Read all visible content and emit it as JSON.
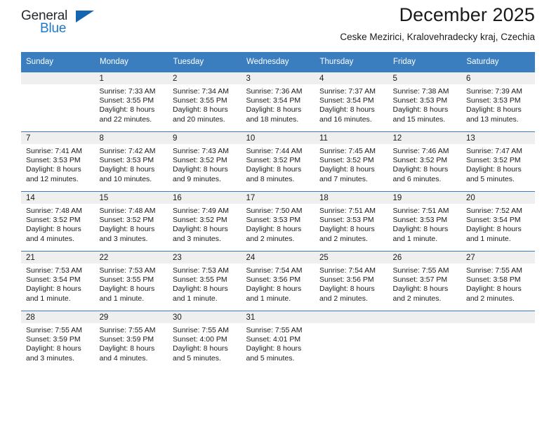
{
  "logo": {
    "word_one": "General",
    "word_two": "Blue",
    "triangle": "blue-triangle"
  },
  "header": {
    "title": "December 2025",
    "subtitle": "Ceske Mezirici, Kralovehradecky kraj, Czechia"
  },
  "colors": {
    "header_blue": "#3a7ebf",
    "logo_blue": "#2079c7",
    "daynum_background": "#efefef"
  },
  "labels": {
    "sunrise_prefix": "Sunrise:",
    "sunset_prefix": "Sunset:",
    "daylight_prefix": "Daylight:"
  },
  "weekdays": [
    "Sunday",
    "Monday",
    "Tuesday",
    "Wednesday",
    "Thursday",
    "Friday",
    "Saturday"
  ],
  "weeks": [
    [
      {
        "day": "",
        "sunrise": "",
        "sunset": "",
        "daylight_line1": "",
        "daylight_line2": ""
      },
      {
        "day": "1",
        "sunrise": "Sunrise: 7:33 AM",
        "sunset": "Sunset: 3:55 PM",
        "daylight_line1": "Daylight: 8 hours",
        "daylight_line2": "and 22 minutes."
      },
      {
        "day": "2",
        "sunrise": "Sunrise: 7:34 AM",
        "sunset": "Sunset: 3:55 PM",
        "daylight_line1": "Daylight: 8 hours",
        "daylight_line2": "and 20 minutes."
      },
      {
        "day": "3",
        "sunrise": "Sunrise: 7:36 AM",
        "sunset": "Sunset: 3:54 PM",
        "daylight_line1": "Daylight: 8 hours",
        "daylight_line2": "and 18 minutes."
      },
      {
        "day": "4",
        "sunrise": "Sunrise: 7:37 AM",
        "sunset": "Sunset: 3:54 PM",
        "daylight_line1": "Daylight: 8 hours",
        "daylight_line2": "and 16 minutes."
      },
      {
        "day": "5",
        "sunrise": "Sunrise: 7:38 AM",
        "sunset": "Sunset: 3:53 PM",
        "daylight_line1": "Daylight: 8 hours",
        "daylight_line2": "and 15 minutes."
      },
      {
        "day": "6",
        "sunrise": "Sunrise: 7:39 AM",
        "sunset": "Sunset: 3:53 PM",
        "daylight_line1": "Daylight: 8 hours",
        "daylight_line2": "and 13 minutes."
      }
    ],
    [
      {
        "day": "7",
        "sunrise": "Sunrise: 7:41 AM",
        "sunset": "Sunset: 3:53 PM",
        "daylight_line1": "Daylight: 8 hours",
        "daylight_line2": "and 12 minutes."
      },
      {
        "day": "8",
        "sunrise": "Sunrise: 7:42 AM",
        "sunset": "Sunset: 3:53 PM",
        "daylight_line1": "Daylight: 8 hours",
        "daylight_line2": "and 10 minutes."
      },
      {
        "day": "9",
        "sunrise": "Sunrise: 7:43 AM",
        "sunset": "Sunset: 3:52 PM",
        "daylight_line1": "Daylight: 8 hours",
        "daylight_line2": "and 9 minutes."
      },
      {
        "day": "10",
        "sunrise": "Sunrise: 7:44 AM",
        "sunset": "Sunset: 3:52 PM",
        "daylight_line1": "Daylight: 8 hours",
        "daylight_line2": "and 8 minutes."
      },
      {
        "day": "11",
        "sunrise": "Sunrise: 7:45 AM",
        "sunset": "Sunset: 3:52 PM",
        "daylight_line1": "Daylight: 8 hours",
        "daylight_line2": "and 7 minutes."
      },
      {
        "day": "12",
        "sunrise": "Sunrise: 7:46 AM",
        "sunset": "Sunset: 3:52 PM",
        "daylight_line1": "Daylight: 8 hours",
        "daylight_line2": "and 6 minutes."
      },
      {
        "day": "13",
        "sunrise": "Sunrise: 7:47 AM",
        "sunset": "Sunset: 3:52 PM",
        "daylight_line1": "Daylight: 8 hours",
        "daylight_line2": "and 5 minutes."
      }
    ],
    [
      {
        "day": "14",
        "sunrise": "Sunrise: 7:48 AM",
        "sunset": "Sunset: 3:52 PM",
        "daylight_line1": "Daylight: 8 hours",
        "daylight_line2": "and 4 minutes."
      },
      {
        "day": "15",
        "sunrise": "Sunrise: 7:48 AM",
        "sunset": "Sunset: 3:52 PM",
        "daylight_line1": "Daylight: 8 hours",
        "daylight_line2": "and 3 minutes."
      },
      {
        "day": "16",
        "sunrise": "Sunrise: 7:49 AM",
        "sunset": "Sunset: 3:52 PM",
        "daylight_line1": "Daylight: 8 hours",
        "daylight_line2": "and 3 minutes."
      },
      {
        "day": "17",
        "sunrise": "Sunrise: 7:50 AM",
        "sunset": "Sunset: 3:53 PM",
        "daylight_line1": "Daylight: 8 hours",
        "daylight_line2": "and 2 minutes."
      },
      {
        "day": "18",
        "sunrise": "Sunrise: 7:51 AM",
        "sunset": "Sunset: 3:53 PM",
        "daylight_line1": "Daylight: 8 hours",
        "daylight_line2": "and 2 minutes."
      },
      {
        "day": "19",
        "sunrise": "Sunrise: 7:51 AM",
        "sunset": "Sunset: 3:53 PM",
        "daylight_line1": "Daylight: 8 hours",
        "daylight_line2": "and 1 minute."
      },
      {
        "day": "20",
        "sunrise": "Sunrise: 7:52 AM",
        "sunset": "Sunset: 3:54 PM",
        "daylight_line1": "Daylight: 8 hours",
        "daylight_line2": "and 1 minute."
      }
    ],
    [
      {
        "day": "21",
        "sunrise": "Sunrise: 7:53 AM",
        "sunset": "Sunset: 3:54 PM",
        "daylight_line1": "Daylight: 8 hours",
        "daylight_line2": "and 1 minute."
      },
      {
        "day": "22",
        "sunrise": "Sunrise: 7:53 AM",
        "sunset": "Sunset: 3:55 PM",
        "daylight_line1": "Daylight: 8 hours",
        "daylight_line2": "and 1 minute."
      },
      {
        "day": "23",
        "sunrise": "Sunrise: 7:53 AM",
        "sunset": "Sunset: 3:55 PM",
        "daylight_line1": "Daylight: 8 hours",
        "daylight_line2": "and 1 minute."
      },
      {
        "day": "24",
        "sunrise": "Sunrise: 7:54 AM",
        "sunset": "Sunset: 3:56 PM",
        "daylight_line1": "Daylight: 8 hours",
        "daylight_line2": "and 1 minute."
      },
      {
        "day": "25",
        "sunrise": "Sunrise: 7:54 AM",
        "sunset": "Sunset: 3:56 PM",
        "daylight_line1": "Daylight: 8 hours",
        "daylight_line2": "and 2 minutes."
      },
      {
        "day": "26",
        "sunrise": "Sunrise: 7:55 AM",
        "sunset": "Sunset: 3:57 PM",
        "daylight_line1": "Daylight: 8 hours",
        "daylight_line2": "and 2 minutes."
      },
      {
        "day": "27",
        "sunrise": "Sunrise: 7:55 AM",
        "sunset": "Sunset: 3:58 PM",
        "daylight_line1": "Daylight: 8 hours",
        "daylight_line2": "and 2 minutes."
      }
    ],
    [
      {
        "day": "28",
        "sunrise": "Sunrise: 7:55 AM",
        "sunset": "Sunset: 3:59 PM",
        "daylight_line1": "Daylight: 8 hours",
        "daylight_line2": "and 3 minutes."
      },
      {
        "day": "29",
        "sunrise": "Sunrise: 7:55 AM",
        "sunset": "Sunset: 3:59 PM",
        "daylight_line1": "Daylight: 8 hours",
        "daylight_line2": "and 4 minutes."
      },
      {
        "day": "30",
        "sunrise": "Sunrise: 7:55 AM",
        "sunset": "Sunset: 4:00 PM",
        "daylight_line1": "Daylight: 8 hours",
        "daylight_line2": "and 5 minutes."
      },
      {
        "day": "31",
        "sunrise": "Sunrise: 7:55 AM",
        "sunset": "Sunset: 4:01 PM",
        "daylight_line1": "Daylight: 8 hours",
        "daylight_line2": "and 5 minutes."
      },
      {
        "day": "",
        "sunrise": "",
        "sunset": "",
        "daylight_line1": "",
        "daylight_line2": ""
      },
      {
        "day": "",
        "sunrise": "",
        "sunset": "",
        "daylight_line1": "",
        "daylight_line2": ""
      },
      {
        "day": "",
        "sunrise": "",
        "sunset": "",
        "daylight_line1": "",
        "daylight_line2": ""
      }
    ]
  ]
}
